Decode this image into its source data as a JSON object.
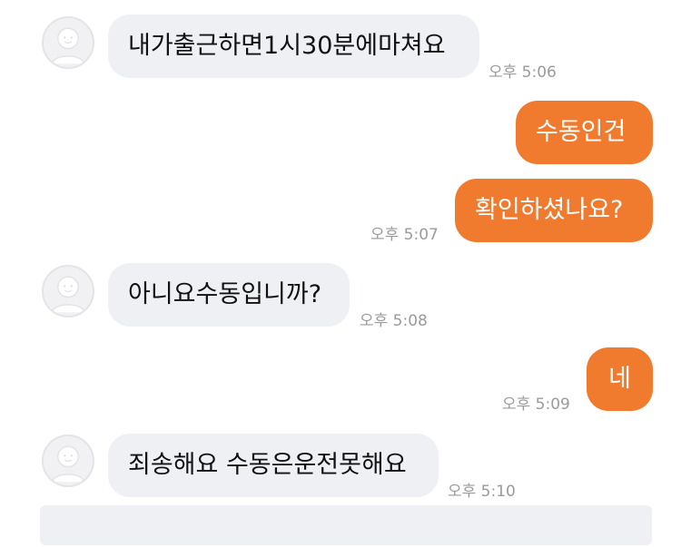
{
  "messages": [
    {
      "direction": "incoming",
      "text": "내가출근하면1시30분에마쳐요",
      "time": "오후 5:06"
    },
    {
      "direction": "outgoing",
      "text": "수동인건"
    },
    {
      "direction": "outgoing",
      "text": "확인하셨나요?",
      "time": "오후 5:07"
    },
    {
      "direction": "incoming",
      "text": "아니요수동입니까?",
      "time": "오후 5:08"
    },
    {
      "direction": "outgoing",
      "text": "네",
      "time": "오후 5:09"
    },
    {
      "direction": "incoming",
      "text": "죄송해요 수동은운전못해요",
      "time": "오후 5:10"
    }
  ],
  "icons": {
    "avatar": "default-profile-avatar-icon"
  },
  "colors": {
    "outgoing_bubble": "#f07a2e",
    "incoming_bubble": "#eef0f4",
    "timestamp": "#9a9aa0"
  }
}
